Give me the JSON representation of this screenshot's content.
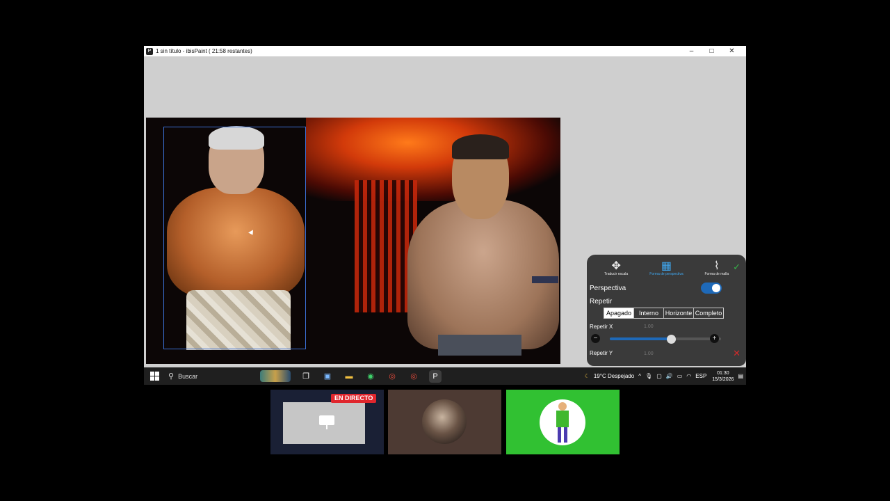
{
  "window": {
    "title": "1 sin título - ibisPaint ( 21:58 restantes)",
    "minimize": "–",
    "maximize": "□",
    "close": "✕"
  },
  "transform_panel": {
    "tools": [
      {
        "label": "Traducir escala",
        "icon": "move-arrows-icon",
        "glyph": "✥"
      },
      {
        "label": "Forma de perspectiva",
        "icon": "perspective-grid-icon",
        "glyph": "▦"
      },
      {
        "label": "Forma de malla",
        "icon": "mesh-warp-icon",
        "glyph": "⌇"
      }
    ],
    "confirm_glyph": "✓",
    "cancel_glyph": "✕",
    "perspectiva_label": "Perspectiva",
    "perspectiva_on": true,
    "repetir_label": "Repetir",
    "repeat_modes": [
      "Apagado",
      "Interno",
      "Horizonte",
      "Completo"
    ],
    "repeat_selected": "Apagado",
    "repetir_x_label": "Repetir X",
    "repetir_x_value": "1.00",
    "repetir_x_level": 0.55,
    "repetir_y_label": "Repetir Y",
    "repetir_y_value": "1.00",
    "minus": "−",
    "plus": "+"
  },
  "taskbar": {
    "search_label": "Buscar",
    "weather": "19°C  Despejado",
    "language": "ESP",
    "time": "01:30",
    "date": "15/3/2026",
    "whatsapp_badge": "3",
    "notification_badge": "3"
  },
  "tiles": {
    "live_badge": "EN DIRECTO"
  },
  "colors": {
    "accent": "#1e69b8",
    "live": "#e0262d",
    "tile_green": "#31c132"
  }
}
